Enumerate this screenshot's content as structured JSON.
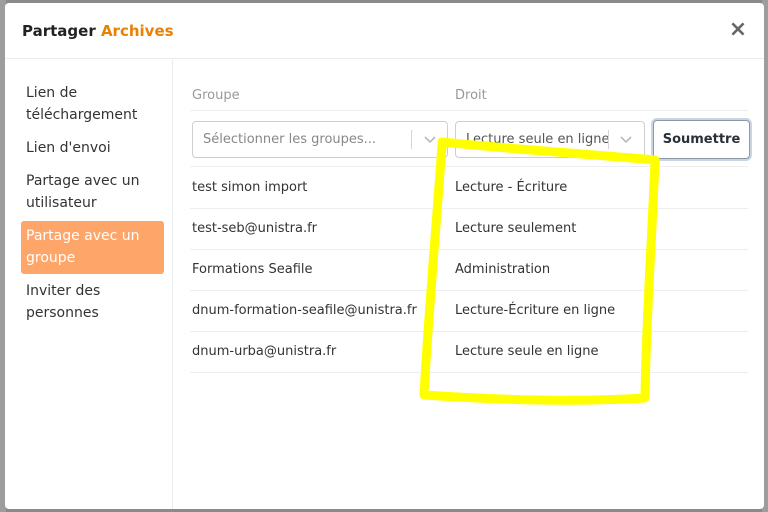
{
  "dialog": {
    "title_prefix": "Partager",
    "title_name": "Archives",
    "close_symbol": "×"
  },
  "sidebar": {
    "items": [
      {
        "label": "Lien de téléchargement",
        "active": false
      },
      {
        "label": "Lien d'envoi",
        "active": false
      },
      {
        "label": "Partage avec un utilisateur",
        "active": false
      },
      {
        "label": "Partage avec un groupe",
        "active": true
      },
      {
        "label": "Inviter des personnes",
        "active": false
      }
    ]
  },
  "form": {
    "group_header": "Groupe",
    "permission_header": "Droit",
    "group_select_placeholder": "Sélectionner les groupes...",
    "permission_select_value": "Lecture seule en ligne",
    "submit_label": "Soumettre"
  },
  "shares": [
    {
      "group": "test simon import",
      "permission": "Lecture - Écriture"
    },
    {
      "group": "test-seb@unistra.fr",
      "permission": "Lecture seulement"
    },
    {
      "group": "Formations Seafile",
      "permission": "Administration"
    },
    {
      "group": "dnum-formation-seafile@unistra.fr",
      "permission": "Lecture-Écriture en ligne"
    },
    {
      "group": "dnum-urba@unistra.fr",
      "permission": "Lecture seule en ligne"
    }
  ],
  "colors": {
    "accent": "#ec8000",
    "active_tab": "#fea56a",
    "highlight_annotation": "#ffff00"
  }
}
